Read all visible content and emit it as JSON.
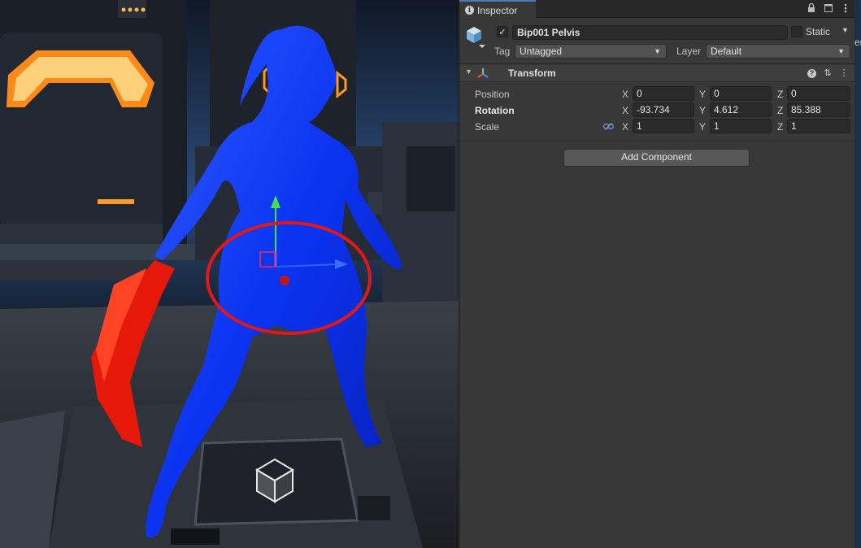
{
  "inspector": {
    "tab_label": "Inspector",
    "object_name": "Bip001 Pelvis",
    "active": true,
    "static_label": "Static",
    "tag_label": "Tag",
    "tag_value": "Untagged",
    "layer_label": "Layer",
    "layer_value": "Default",
    "component_title": "Transform",
    "rows": [
      {
        "label": "Position",
        "x": "0",
        "y": "0",
        "z": "0"
      },
      {
        "label": "Rotation",
        "x": "-93.734",
        "y": "4.612",
        "z": "85.388"
      },
      {
        "label": "Scale",
        "x": "1",
        "y": "1",
        "z": "1"
      }
    ],
    "axis_labels": {
      "x": "X",
      "y": "Y",
      "z": "Z"
    },
    "add_component_label": "Add Component"
  },
  "right_panel_fragment": "er",
  "icons": [
    "info-icon",
    "lock-icon",
    "maximize-icon",
    "close-icon",
    "gameobject-cube-icon",
    "transform-icon",
    "help-icon",
    "preset-icon",
    "more-icon",
    "link-icon",
    "fold-arrow-icon",
    "dropdown-arrow-icon"
  ],
  "colors": {
    "accent": "#4a7ab8",
    "panel": "#383838",
    "character": "#0a35ff",
    "sword": "#e01a0a",
    "annotation": "#e01818",
    "glow": "#ff9a1a"
  }
}
